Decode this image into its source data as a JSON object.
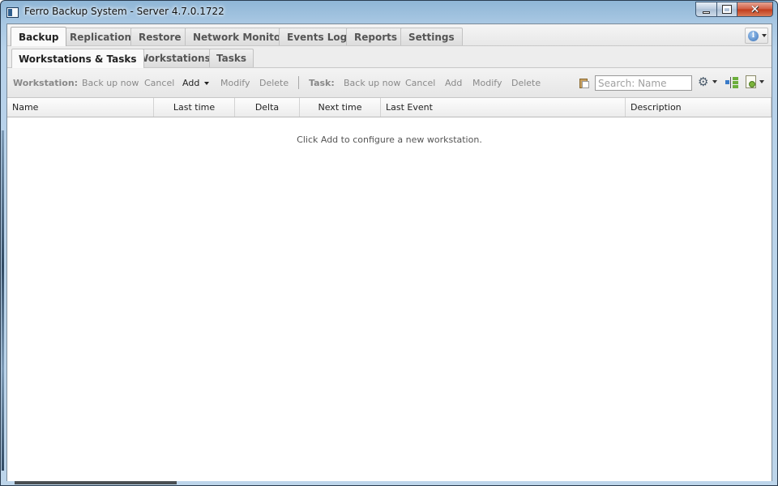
{
  "window": {
    "title": "Ferro Backup System - Server 4.7.0.1722",
    "icon": "app-window-icon"
  },
  "main_tabs": [
    {
      "label": "Backup",
      "active": true
    },
    {
      "label": "Replication",
      "active": false
    },
    {
      "label": "Restore",
      "active": false
    },
    {
      "label": "Network Monitor",
      "active": false
    },
    {
      "label": "Events Log",
      "active": false
    },
    {
      "label": "Reports",
      "active": false
    },
    {
      "label": "Settings",
      "active": false
    }
  ],
  "help_button": {
    "icon": "info-icon"
  },
  "sub_tabs": [
    {
      "label": "Workstations & Tasks",
      "active": true
    },
    {
      "label": "Workstations",
      "active": false
    },
    {
      "label": "Tasks",
      "active": false
    }
  ],
  "toolbar": {
    "workstation_label": "Workstation:",
    "workstation_actions": {
      "backup_now": "Back up now",
      "cancel": "Cancel",
      "add": "Add",
      "modify": "Modify",
      "delete": "Delete"
    },
    "task_label": "Task:",
    "task_actions": {
      "backup_now": "Back up now",
      "cancel": "Cancel",
      "add": "Add",
      "modify": "Modify",
      "delete": "Delete"
    },
    "search": {
      "placeholder": "Search: Name",
      "value": ""
    },
    "icons": [
      "clipboard-icon",
      "gear-icon",
      "tree-view-icon",
      "export-document-icon"
    ]
  },
  "table": {
    "columns": [
      "Name",
      "Last time",
      "Delta",
      "Next time",
      "Last Event",
      "Description"
    ],
    "rows": [],
    "empty_message": "Click Add to configure a new workstation."
  }
}
